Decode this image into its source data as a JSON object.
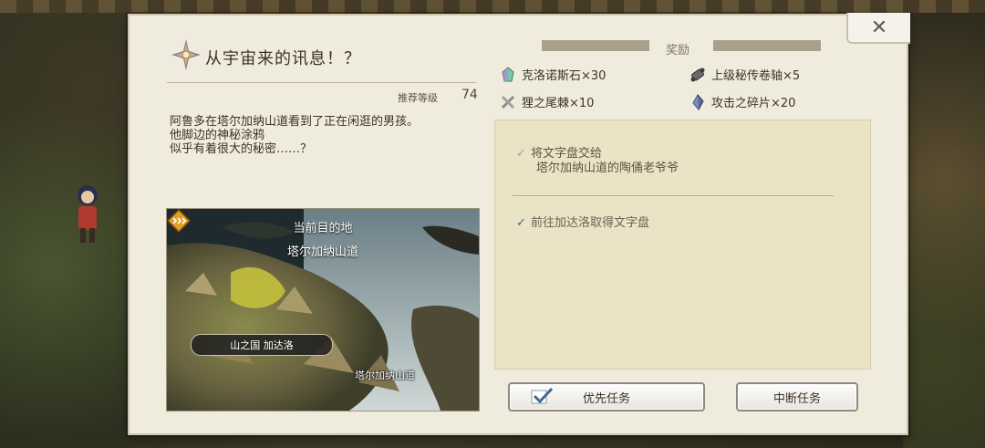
{
  "quest": {
    "title": "从宇宙来的讯息！？",
    "recommended_level_label": "推荐等级",
    "recommended_level": "74",
    "description": [
      "阿鲁多在塔尔加纳山道看到了正在闲逛的男孩。",
      "他脚边的神秘涂鸦",
      "似乎有着很大的秘密……？"
    ]
  },
  "map": {
    "current_label": "当前目的地",
    "current_place": "塔尔加纳山道",
    "region_tag": "山之国 加达洛",
    "destination_label": "塔尔加纳山道"
  },
  "rewards": {
    "title": "奖励",
    "items": [
      {
        "label": "克洛诺斯石×30",
        "icon": "crystal-icon"
      },
      {
        "label": "上级秘传卷轴×5",
        "icon": "scroll-icon"
      },
      {
        "label": "狸之尾棘×10",
        "icon": "bone-icon"
      },
      {
        "label": "攻击之碎片×20",
        "icon": "shard-icon"
      }
    ]
  },
  "objectives": [
    {
      "lines": [
        "将文字盘交给",
        "塔尔加纳山道的陶俑老爷爷"
      ],
      "done": true
    },
    {
      "lines": [
        "前往加达洛取得文字盘"
      ],
      "done": false
    }
  ],
  "buttons": {
    "priority": "优先任务",
    "abort": "中断任务",
    "close": "✕"
  },
  "colors": {
    "panel_bg": "#f0ecdd",
    "objective_bg": "#ebe3c6",
    "accent_check": "#3f6b8a",
    "marker": "#e2a020"
  }
}
